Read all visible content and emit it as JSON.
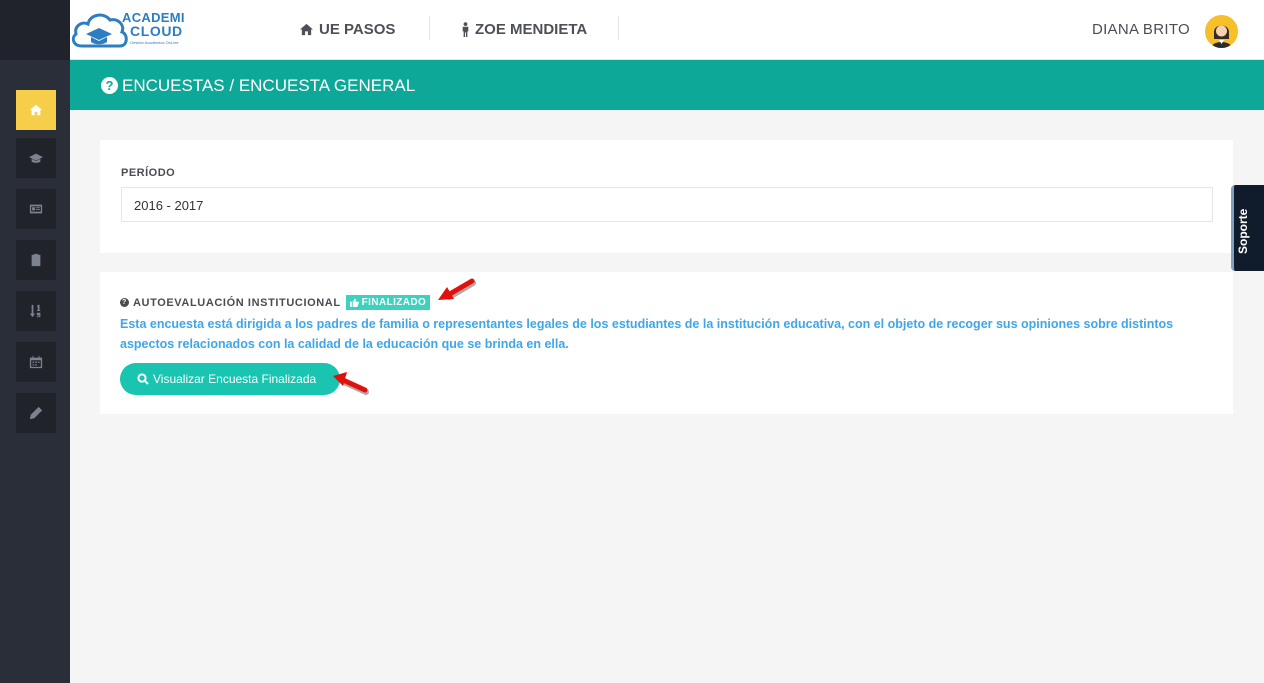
{
  "app": {
    "logo_line1": "ACADEMI",
    "logo_line2": "CLOUD",
    "logo_tagline": "Gestión Académica OnLine"
  },
  "header": {
    "nav": [
      {
        "label": "UE PASOS",
        "icon": "home-icon"
      },
      {
        "label": "ZOE MENDIETA",
        "icon": "person-icon"
      }
    ],
    "user_name": "DIANA BRITO"
  },
  "sidebar": {
    "items": [
      {
        "icon": "home-icon",
        "active": true
      },
      {
        "icon": "graduation-cap-icon",
        "active": false
      },
      {
        "icon": "id-card-icon",
        "active": false
      },
      {
        "icon": "clipboard-icon",
        "active": false
      },
      {
        "icon": "sort-numeric-icon",
        "active": false
      },
      {
        "icon": "calendar-icon",
        "active": false
      },
      {
        "icon": "pencil-icon",
        "active": false
      }
    ]
  },
  "page": {
    "title": "ENCUESTAS / ENCUESTA GENERAL"
  },
  "period": {
    "label": "PERÍODO",
    "value": "2016 - 2017"
  },
  "survey": {
    "title": "AUTOEVALUACIÓN INSTITUCIONAL",
    "status_badge": "FINALIZADO",
    "description": "Esta encuesta está dirigida a los padres de familia o representantes legales de los estudiantes de la institución educativa, con el objeto de recoger sus opiniones sobre distintos aspectos relacionados con la calidad de la educación que se brinda en ella.",
    "view_button": "Visualizar Encuesta Finalizada"
  },
  "support": {
    "label": "Soporte"
  },
  "colors": {
    "teal": "#0ea898",
    "accent_yellow": "#f7ce4a",
    "sidebar_dark": "#2a2e38",
    "link_blue": "#3fa6e8"
  }
}
